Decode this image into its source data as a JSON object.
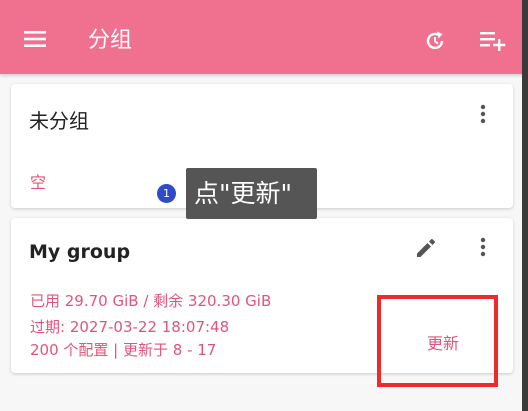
{
  "appbar": {
    "title": "分组",
    "color": "#f0718f"
  },
  "groups": [
    {
      "name": "未分组",
      "empty_label": "空"
    },
    {
      "name": "My group",
      "usage": "已用 29.70 GiB / 剩余 320.30 GiB",
      "expiry": "过期: 2027-03-22 18:07:48",
      "summary": "200 个配置 | 更新于 8 - 17",
      "update_label": "更新"
    }
  ],
  "tutorial": {
    "step_number": "1",
    "tooltip_text": "点\"更新\"",
    "highlight_color": "#ee2a2a"
  },
  "icons": {
    "menu": "menu-icon",
    "refresh": "refresh-icon",
    "add_list": "playlist-add-icon",
    "more": "more-vert-icon",
    "edit": "edit-pencil-icon"
  }
}
